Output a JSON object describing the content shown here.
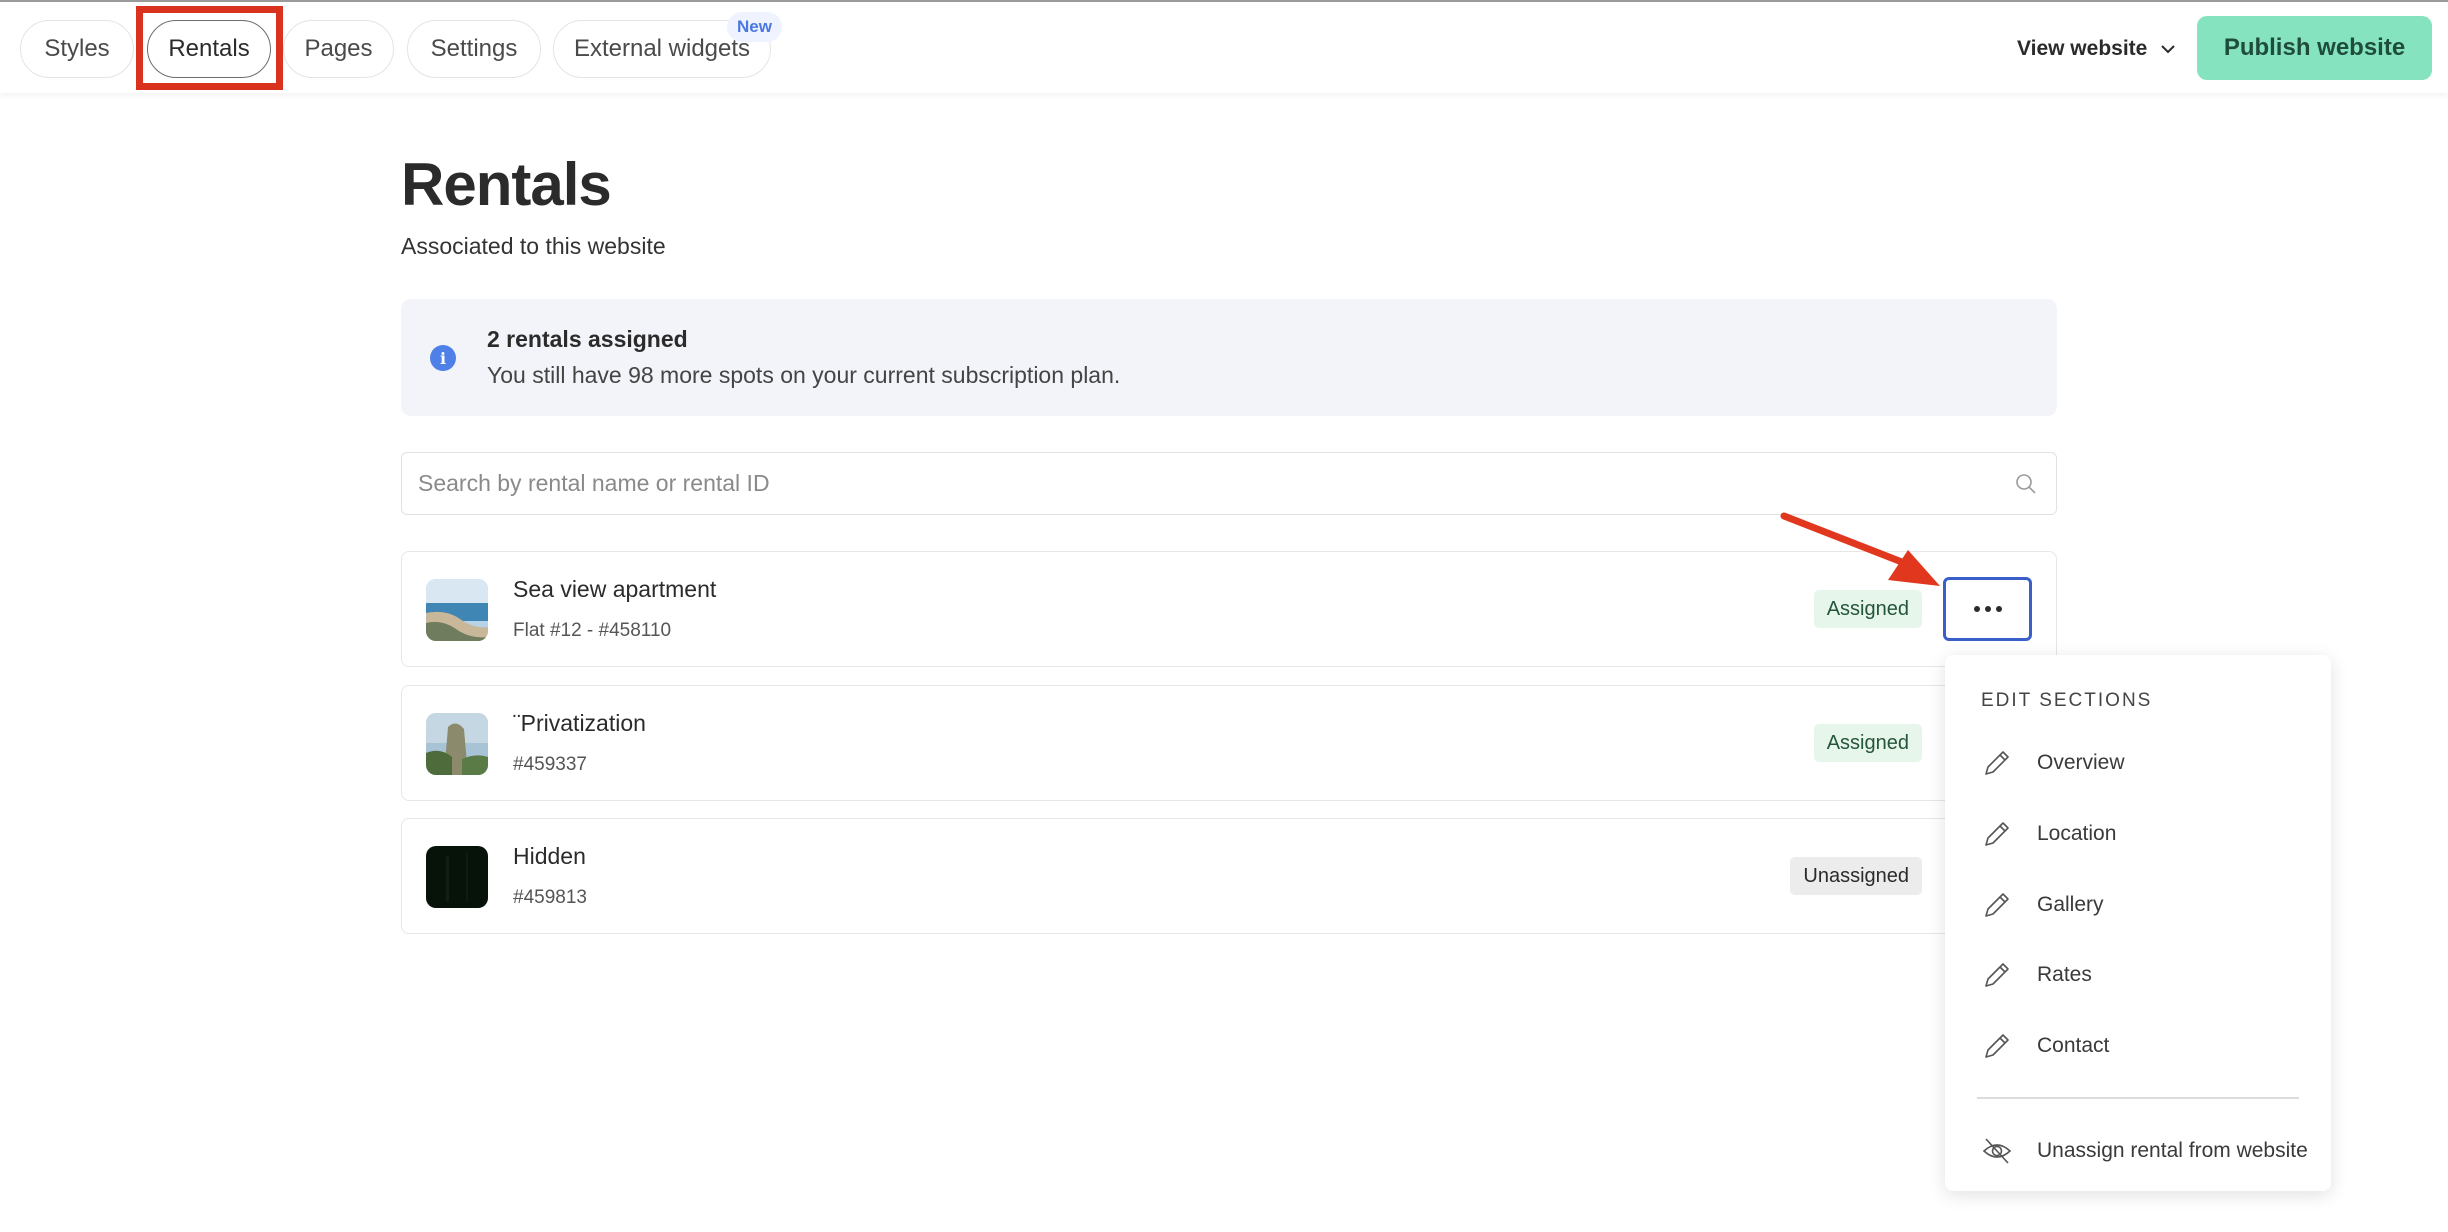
{
  "topbar": {
    "tabs": [
      {
        "label": "Styles"
      },
      {
        "label": "Rentals",
        "active": true
      },
      {
        "label": "Pages"
      },
      {
        "label": "Settings"
      },
      {
        "label": "External widgets",
        "badge": "New"
      }
    ],
    "view_website": "View website",
    "publish": "Publish website"
  },
  "main": {
    "title": "Rentals",
    "subtitle": "Associated to this website",
    "info": {
      "icon": "info-icon",
      "title": "2 rentals assigned",
      "text": "You still have 98 more spots on your current subscription plan."
    },
    "search": {
      "placeholder": "Search by rental name or rental ID",
      "icon": "search-icon"
    },
    "rentals": [
      {
        "name": "Sea view apartment",
        "sub": "Flat #12 - #458110",
        "status": "Assigned"
      },
      {
        "name": "¨Privatization",
        "sub": "#459337",
        "status": "Assigned"
      },
      {
        "name": "Hidden",
        "sub": "#459813",
        "status": "Unassigned"
      }
    ]
  },
  "menu": {
    "heading": "EDIT SECTIONS",
    "items": [
      "Overview",
      "Location",
      "Gallery",
      "Rates",
      "Contact"
    ],
    "unassign": "Unassign rental from website"
  },
  "colors": {
    "publish_bg": "#86e3c0",
    "highlight": "#d9321e",
    "more_button_border": "#3a5fc8",
    "assigned_bg": "#e6f6ea",
    "info_bg": "#f3f4f9"
  }
}
